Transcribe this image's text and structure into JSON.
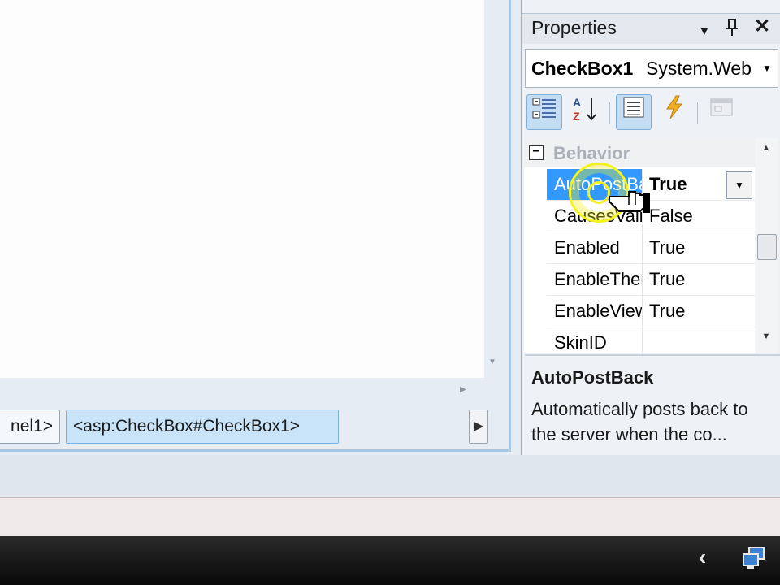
{
  "designer": {
    "breadcrumbs": [
      "nel1>",
      "<asp:CheckBox#CheckBox1>"
    ],
    "nav_arrow": "▶"
  },
  "properties_panel": {
    "title": "Properties",
    "object_name": "CheckBox1",
    "object_type": "System.Web",
    "category": "Behavior",
    "rows": [
      {
        "name": "AutoPostBack",
        "value": "True",
        "selected": true
      },
      {
        "name": "CausesValidation",
        "value": "False"
      },
      {
        "name": "Enabled",
        "value": "True"
      },
      {
        "name": "EnableTheming",
        "value": "True"
      },
      {
        "name": "EnableViewState",
        "value": "True"
      },
      {
        "name": "SkinID",
        "value": ""
      }
    ],
    "description_title": "AutoPostBack",
    "description_text": "Automatically posts back to the server when the co..."
  },
  "toolbar_icons": [
    "categorized-icon",
    "alphabetical-icon",
    "properties-icon",
    "events-icon",
    "property-pages-icon"
  ],
  "colors": {
    "selection": "#3399ff",
    "cursor_highlight": "#f4f21e",
    "taskbar": "#111111"
  }
}
